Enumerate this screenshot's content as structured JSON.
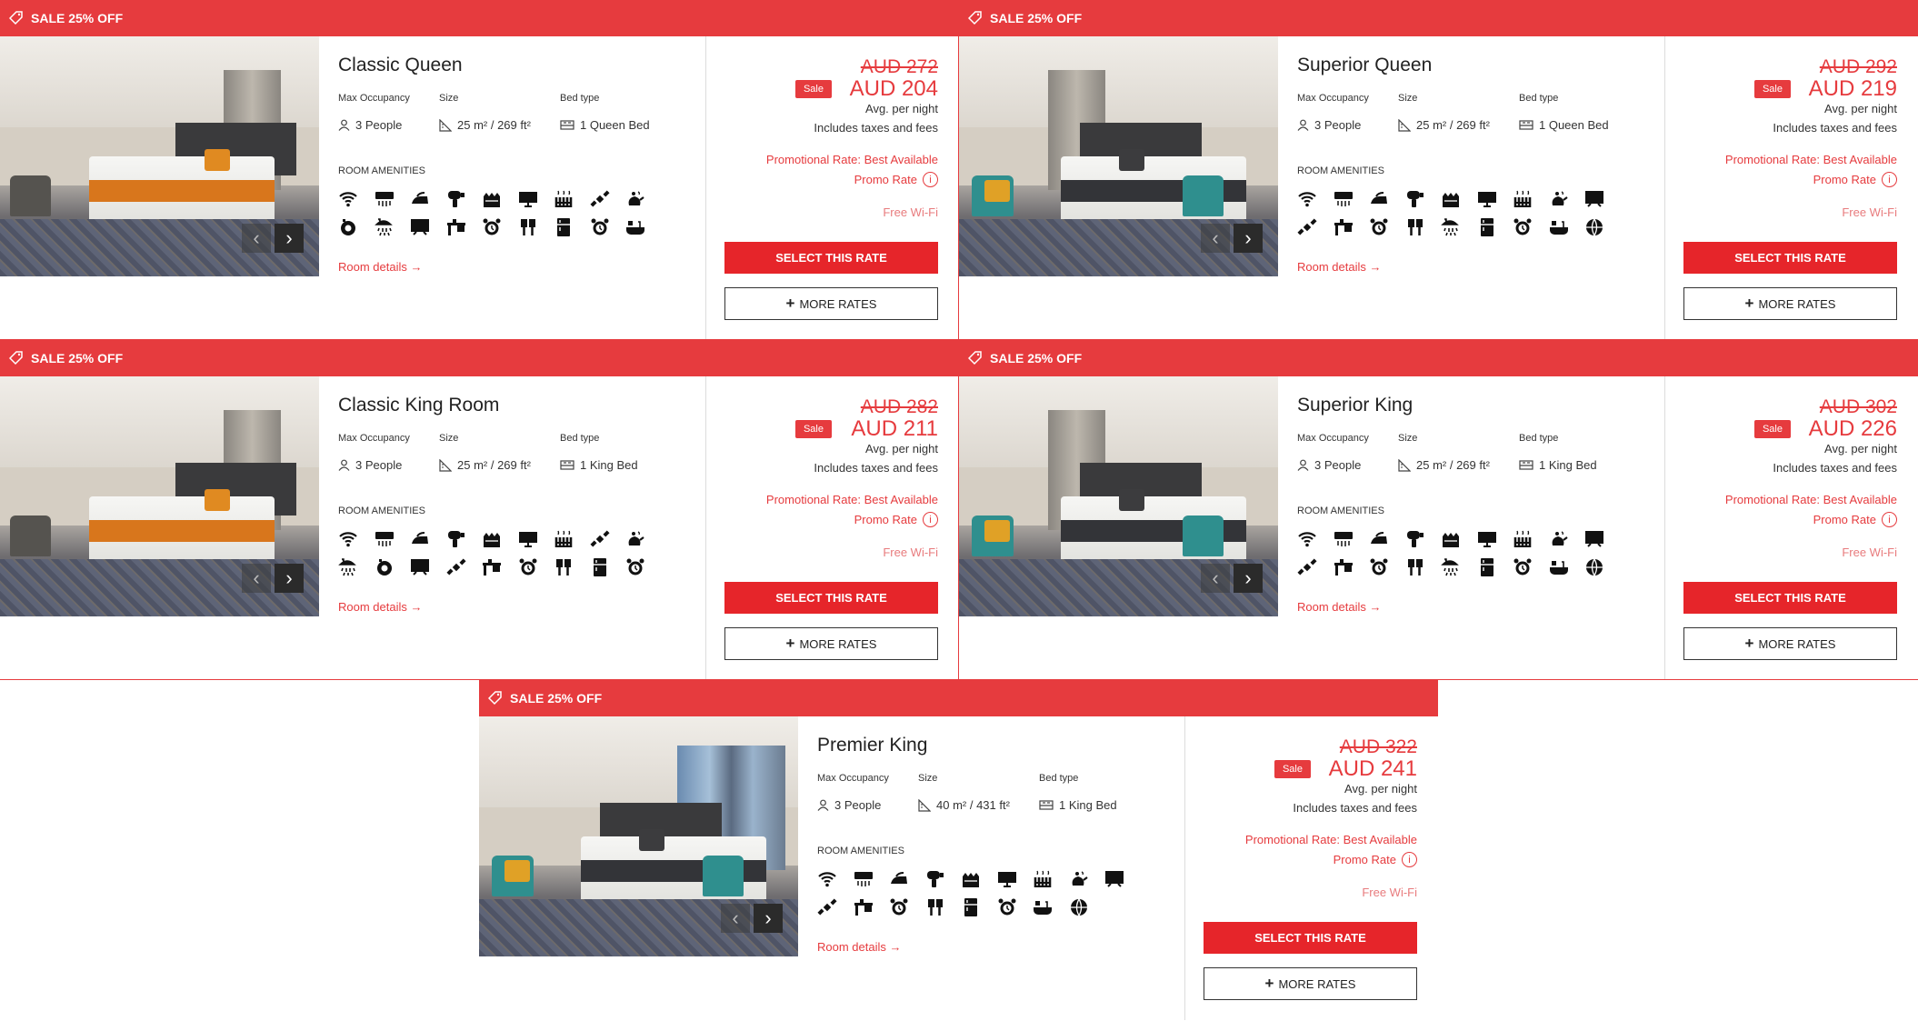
{
  "labels": {
    "banner": "SALE 25% OFF",
    "max_occupancy": "Max Occupancy",
    "size": "Size",
    "bed_type": "Bed type",
    "room_amenities": "ROOM AMENITIES",
    "room_details": "Room details →",
    "sale_badge": "Sale",
    "avg_per_night": "Avg. per night",
    "includes_taxes": "Includes taxes and fees",
    "promo_line1": "Promotional Rate: Best Available",
    "promo_line2": "Promo Rate",
    "free_wifi": "Free Wi-Fi",
    "select_rate": "SELECT THIS RATE",
    "more_rates": "MORE RATES"
  },
  "colors": {
    "accent": "#e63b3e",
    "button": "#e6252a"
  },
  "rooms": [
    {
      "name": "Classic Queen",
      "occupancy": "3 People",
      "size": "25 m² / 269 ft²",
      "bed": "1 Queen Bed",
      "old_price": "AUD 272",
      "price": "AUD 204",
      "photo_theme": "orange-runner",
      "amenity_icons": [
        "wifi-icon",
        "air-conditioning-icon",
        "iron-icon",
        "hair-dryer-icon",
        "laundry-icon",
        "tv-icon",
        "heater-icon",
        "satellite-icon",
        "tea-kettle-icon",
        "safe-icon",
        "shower-icon",
        "blackboard-icon",
        "desk-icon",
        "alarm-clock-icon",
        "kitchen-icon",
        "fridge-icon",
        "alarm-clock-icon",
        "bathtub-icon"
      ]
    },
    {
      "name": "Superior Queen",
      "occupancy": "3 People",
      "size": "25 m² / 269 ft²",
      "bed": "1 Queen Bed",
      "old_price": "AUD 292",
      "price": "AUD 219",
      "photo_theme": "teal-chairs",
      "amenity_icons": [
        "wifi-icon",
        "air-conditioning-icon",
        "iron-icon",
        "hair-dryer-icon",
        "laundry-icon",
        "tv-icon",
        "heater-icon",
        "tea-kettle-icon",
        "blackboard-icon",
        "satellite-icon",
        "desk-icon",
        "alarm-clock-icon",
        "kitchen-icon",
        "shower-icon",
        "fridge-icon",
        "alarm-clock-icon",
        "bathtub-icon",
        "globe-icon"
      ]
    },
    {
      "name": "Classic King Room",
      "occupancy": "3 People",
      "size": "25 m² / 269 ft²",
      "bed": "1 King Bed",
      "old_price": "AUD 282",
      "price": "AUD 211",
      "photo_theme": "orange-runner",
      "amenity_icons": [
        "wifi-icon",
        "air-conditioning-icon",
        "iron-icon",
        "hair-dryer-icon",
        "laundry-icon",
        "tv-icon",
        "heater-icon",
        "satellite-icon",
        "tea-kettle-icon",
        "shower-icon",
        "safe-icon",
        "blackboard-icon",
        "satellite-icon",
        "desk-icon",
        "alarm-clock-icon",
        "kitchen-icon",
        "fridge-icon",
        "alarm-clock-icon"
      ]
    },
    {
      "name": "Superior King",
      "occupancy": "3 People",
      "size": "25 m² / 269 ft²",
      "bed": "1 King Bed",
      "old_price": "AUD 302",
      "price": "AUD 226",
      "photo_theme": "teal-chairs",
      "amenity_icons": [
        "wifi-icon",
        "air-conditioning-icon",
        "iron-icon",
        "hair-dryer-icon",
        "laundry-icon",
        "tv-icon",
        "heater-icon",
        "tea-kettle-icon",
        "blackboard-icon",
        "satellite-icon",
        "desk-icon",
        "alarm-clock-icon",
        "kitchen-icon",
        "shower-icon",
        "fridge-icon",
        "alarm-clock-icon",
        "bathtub-icon",
        "globe-icon"
      ]
    },
    {
      "name": "Premier King",
      "occupancy": "3 People",
      "size": "40 m² / 431 ft²",
      "bed": "1 King Bed",
      "old_price": "AUD 322",
      "price": "AUD 241",
      "photo_theme": "city-view",
      "amenity_icons": [
        "wifi-icon",
        "air-conditioning-icon",
        "iron-icon",
        "hair-dryer-icon",
        "laundry-icon",
        "tv-icon",
        "heater-icon",
        "tea-kettle-icon",
        "blackboard-icon",
        "satellite-icon",
        "desk-icon",
        "alarm-clock-icon",
        "kitchen-icon",
        "fridge-icon",
        "alarm-clock-icon",
        "bathtub-icon",
        "globe-icon"
      ]
    }
  ]
}
